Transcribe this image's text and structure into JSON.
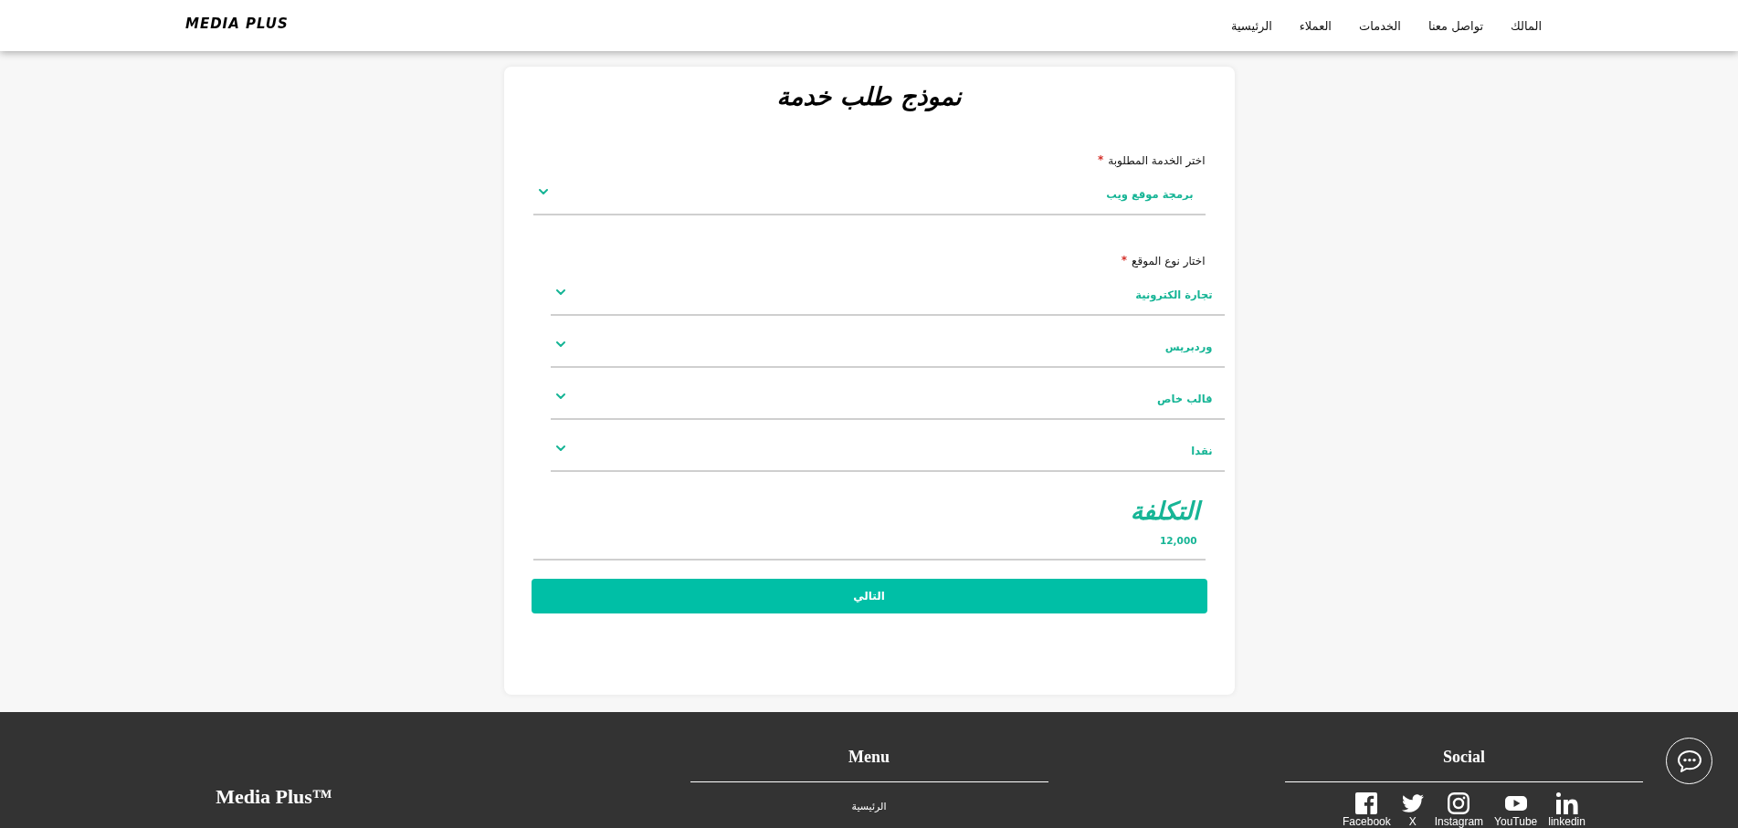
{
  "header": {
    "logo": "MEDIA PLUS",
    "nav": [
      {
        "label": "المالك"
      },
      {
        "label": "تواصل معنا"
      },
      {
        "label": "الخدمات"
      },
      {
        "label": "العملاء"
      },
      {
        "label": "الرئيسية"
      }
    ]
  },
  "form": {
    "title": "نموذج طلب خدمة",
    "groups": [
      {
        "kind": "single",
        "label": "اختر الخدمة المطلوبة",
        "required_mark": "*",
        "selects": [
          {
            "value": "برمجة موقع ويب"
          }
        ]
      },
      {
        "kind": "stacked",
        "label": "اختار نوع الموقع",
        "required_mark": "*",
        "selects": [
          {
            "value": "تجارة الكترونية"
          },
          {
            "value": "وردبريس"
          },
          {
            "value": "قالب خاص"
          },
          {
            "value": "نقدا"
          }
        ]
      }
    ],
    "cost": {
      "label": "التكلفة",
      "value": "12,000"
    },
    "submit": "التالي"
  },
  "footer": {
    "brand": "Media Plus™",
    "menu": {
      "title": "Menu",
      "items": [
        {
          "label": "الرئيسية"
        }
      ]
    },
    "social": {
      "title": "Social",
      "links": [
        {
          "kind": "linkedin",
          "label": "linkedin"
        },
        {
          "kind": "youtube",
          "label": "YouTube"
        },
        {
          "kind": "instagram",
          "label": "Instagram"
        },
        {
          "kind": "x",
          "label": "X"
        },
        {
          "kind": "facebook",
          "label": "Facebook"
        }
      ]
    }
  }
}
